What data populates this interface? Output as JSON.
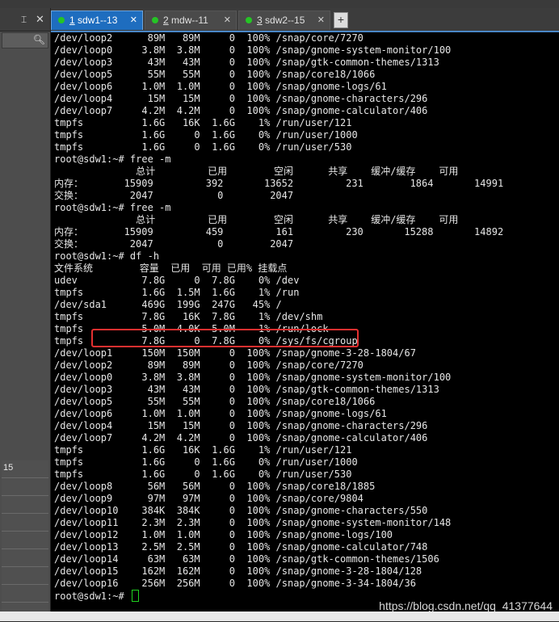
{
  "left_panel": {
    "pin_glyph": "⌶",
    "close_glyph": "✕",
    "search_icon": "search-icon",
    "list_rows": [
      "15",
      "",
      "",
      "",
      "",
      "",
      "",
      "",
      ""
    ]
  },
  "tabs": [
    {
      "num": "1",
      "label": " sdw1--13",
      "close": "✕",
      "active": true,
      "status_color": "#25c425"
    },
    {
      "num": "2",
      "label": " mdw--11",
      "close": "✕",
      "active": false,
      "status_color": "#25c425"
    },
    {
      "num": "3",
      "label": " sdw2--15",
      "close": "✕",
      "active": false,
      "status_color": "#25c425"
    }
  ],
  "tab_add_label": "+",
  "terminal": {
    "lines": [
      "/dev/loop2      89M   89M     0  100% /snap/core/7270",
      "/dev/loop0     3.8M  3.8M     0  100% /snap/gnome-system-monitor/100",
      "/dev/loop3      43M   43M     0  100% /snap/gtk-common-themes/1313",
      "/dev/loop5      55M   55M     0  100% /snap/core18/1066",
      "/dev/loop6     1.0M  1.0M     0  100% /snap/gnome-logs/61",
      "/dev/loop4      15M   15M     0  100% /snap/gnome-characters/296",
      "/dev/loop7     4.2M  4.2M     0  100% /snap/gnome-calculator/406",
      "tmpfs          1.6G   16K  1.6G    1% /run/user/121",
      "tmpfs          1.6G     0  1.6G    0% /run/user/1000",
      "tmpfs          1.6G     0  1.6G    0% /run/user/530",
      "root@sdw1:~# free -m",
      "              总计         已用        空闲      共享    缓冲/缓存    可用",
      "内存：       15909         392       13652         231        1864       14991",
      "交换：        2047           0        2047",
      "root@sdw1:~# free -m",
      "              总计         已用        空闲      共享    缓冲/缓存    可用",
      "内存：       15909         459         161         230       15288       14892",
      "交换：        2047           0        2047",
      "root@sdw1:~# df -h",
      "文件系统        容量  已用  可用 已用% 挂载点",
      "udev           7.8G     0  7.8G    0% /dev",
      "tmpfs          1.6G  1.5M  1.6G    1% /run",
      "/dev/sda1      469G  199G  247G   45% /",
      "tmpfs          7.8G   16K  7.8G    1% /dev/shm",
      "tmpfs          5.0M  4.0K  5.0M    1% /run/lock",
      "tmpfs          7.8G     0  7.8G    0% /sys/fs/cgroup",
      "/dev/loop1     150M  150M     0  100% /snap/gnome-3-28-1804/67",
      "/dev/loop2      89M   89M     0  100% /snap/core/7270",
      "/dev/loop0     3.8M  3.8M     0  100% /snap/gnome-system-monitor/100",
      "/dev/loop3      43M   43M     0  100% /snap/gtk-common-themes/1313",
      "/dev/loop5      55M   55M     0  100% /snap/core18/1066",
      "/dev/loop6     1.0M  1.0M     0  100% /snap/gnome-logs/61",
      "/dev/loop4      15M   15M     0  100% /snap/gnome-characters/296",
      "/dev/loop7     4.2M  4.2M     0  100% /snap/gnome-calculator/406",
      "tmpfs          1.6G   16K  1.6G    1% /run/user/121",
      "tmpfs          1.6G     0  1.6G    0% /run/user/1000",
      "tmpfs          1.6G     0  1.6G    0% /run/user/530",
      "/dev/loop8      56M   56M     0  100% /snap/core18/1885",
      "/dev/loop9      97M   97M     0  100% /snap/core/9804",
      "/dev/loop10    384K  384K     0  100% /snap/gnome-characters/550",
      "/dev/loop11    2.3M  2.3M     0  100% /snap/gnome-system-monitor/148",
      "/dev/loop12    1.0M  1.0M     0  100% /snap/gnome-logs/100",
      "/dev/loop13    2.5M  2.5M     0  100% /snap/gnome-calculator/748",
      "/dev/loop14     63M   63M     0  100% /snap/gtk-common-themes/1506",
      "/dev/loop15    162M  162M     0  100% /snap/gnome-3-28-1804/128",
      "/dev/loop16    256M  256M     0  100% /snap/gnome-3-34-1804/36"
    ],
    "prompt": "root@sdw1:~# ",
    "highlight_color": "#e53030",
    "cursor_color": "#1fd11f"
  },
  "watermark": "https://blog.csdn.net/qq_41377644"
}
